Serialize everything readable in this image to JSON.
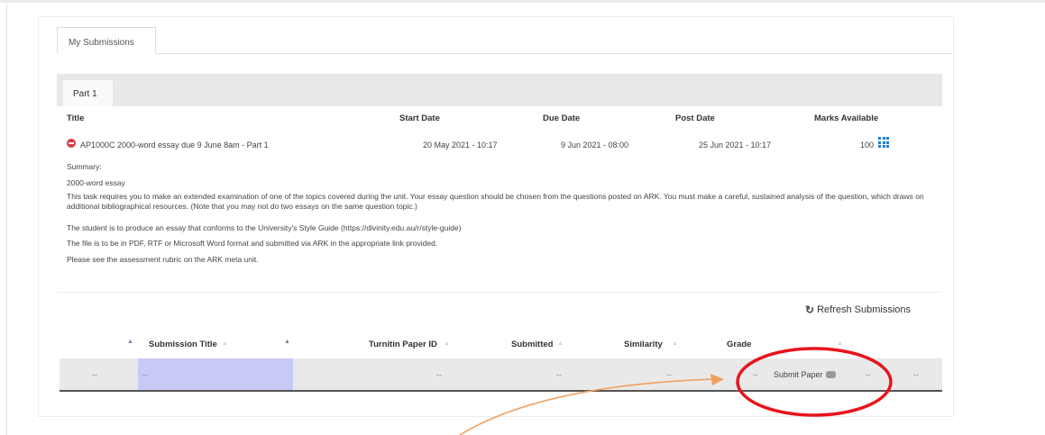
{
  "tabs": {
    "my_submissions": "My Submissions"
  },
  "part": {
    "tab_label": "Part 1",
    "headers": {
      "title": "Title",
      "start_date": "Start Date",
      "due_date": "Due Date",
      "post_date": "Post Date",
      "marks_available": "Marks Available"
    },
    "assignment": {
      "title": "AP1000C 2000-word essay due 9 June 8am - Part 1",
      "start_date": "20 May 2021 - 10:17",
      "due_date": "9 Jun 2021 - 08:00",
      "post_date": "25 Jun 2021 - 10:17",
      "marks": "100"
    },
    "summary": {
      "label": "Summary:",
      "title": "2000-word essay",
      "paragraphs": [
        "This task requires you to make an extended examination of one of the topics covered during the unit. Your essay question should be chosen from the questions posted on ARK. You must make a careful, sustained analysis of the question, which draws on additional bibliographical resources. (Note that you may not do two essays on the same question topic.)",
        "The student is to produce an essay that conforms to the University's Style Guide (https://divinity.edu.au/r/style-guide)",
        "The file is to be in PDF, RTF or Microsoft Word format and submitted via ARK in the appropriate link provided.",
        "Please see the assessment rubric on the ARK meta unit."
      ]
    }
  },
  "submissions": {
    "refresh_label": "Refresh Submissions",
    "refresh_icon": "↻",
    "columns": {
      "submission_title": "Submission Title",
      "turnitin_id": "Turnitin Paper ID",
      "submitted": "Submitted",
      "similarity": "Similarity",
      "grade": "Grade"
    },
    "sort_glyph": "▲",
    "sort_faint_glyph": "▲",
    "empty": "--",
    "submit_label": "Submit Paper"
  },
  "colors": {
    "annotation_circle": "#e8141c",
    "annotation_arrow": "#f0a060",
    "highlight": "#c8c9f5",
    "grid_icon": "#1e7dd2"
  }
}
